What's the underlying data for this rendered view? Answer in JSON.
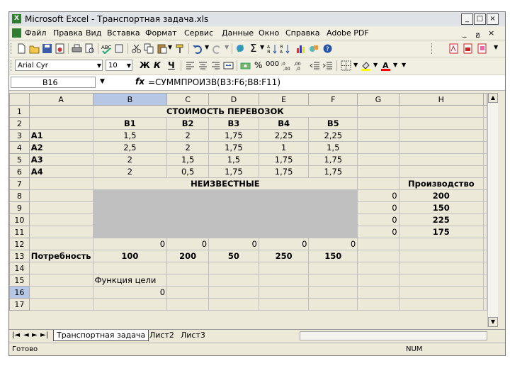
{
  "window": {
    "title": "Microsoft Excel - Транспортная задача.xls"
  },
  "menu": {
    "items": [
      "Файл",
      "Правка",
      "Вид",
      "Вставка",
      "Формат",
      "Сервис",
      "Данные",
      "Окно",
      "Справка",
      "Adobe PDF"
    ],
    "right_controls": [
      "_",
      "ฮ",
      "×"
    ]
  },
  "format_bar": {
    "font": "Arial Cyr",
    "size": "10",
    "percent": "%",
    "thousands": "000"
  },
  "formula_bar": {
    "name_box": "B16",
    "fx": "fx",
    "formula": "=СУММПРОИЗВ(B3:F6;B8:F11)"
  },
  "grid": {
    "columns": [
      "A",
      "B",
      "C",
      "D",
      "E",
      "F",
      "G",
      "H"
    ],
    "rows": [
      [
        "",
        "СТОИМОСТЬ ПЕРЕВОЗОК",
        "",
        "",
        "",
        "",
        "",
        ""
      ],
      [
        "",
        "B1",
        "B2",
        "B3",
        "B4",
        "B5",
        "",
        ""
      ],
      [
        "A1",
        "1,5",
        "2",
        "1,75",
        "2,25",
        "2,25",
        "",
        ""
      ],
      [
        "A2",
        "2,5",
        "2",
        "1,75",
        "1",
        "1,5",
        "",
        ""
      ],
      [
        "A3",
        "2",
        "1,5",
        "1,5",
        "1,75",
        "1,75",
        "",
        ""
      ],
      [
        "A4",
        "2",
        "0,5",
        "1,75",
        "1,75",
        "1,75",
        "",
        ""
      ],
      [
        "",
        "НЕИЗВЕСТНЫЕ",
        "",
        "",
        "",
        "",
        "",
        "Производство"
      ],
      [
        "",
        "",
        "",
        "",
        "",
        "",
        "0",
        "200"
      ],
      [
        "",
        "",
        "",
        "",
        "",
        "",
        "0",
        "150"
      ],
      [
        "",
        "",
        "",
        "",
        "",
        "",
        "0",
        "225"
      ],
      [
        "",
        "",
        "",
        "",
        "",
        "",
        "0",
        "175"
      ],
      [
        "",
        "0",
        "0",
        "0",
        "0",
        "0",
        "",
        ""
      ],
      [
        "Потребность",
        "100",
        "200",
        "50",
        "250",
        "150",
        "",
        ""
      ],
      [
        "",
        "",
        "",
        "",
        "",
        "",
        "",
        ""
      ],
      [
        "",
        "Функция цели",
        "",
        "",
        "",
        "",
        "",
        ""
      ],
      [
        "",
        "0",
        "",
        "",
        "",
        "",
        "",
        ""
      ],
      [
        "",
        "",
        "",
        "",
        "",
        "",
        "",
        ""
      ]
    ]
  },
  "sheet_tabs": [
    "Транспортная задача",
    "Лист2",
    "Лист3"
  ],
  "tab_nav": [
    "|◄",
    "◄",
    "►",
    "►|"
  ],
  "status": {
    "left": "Готово",
    "right": "NUM"
  }
}
